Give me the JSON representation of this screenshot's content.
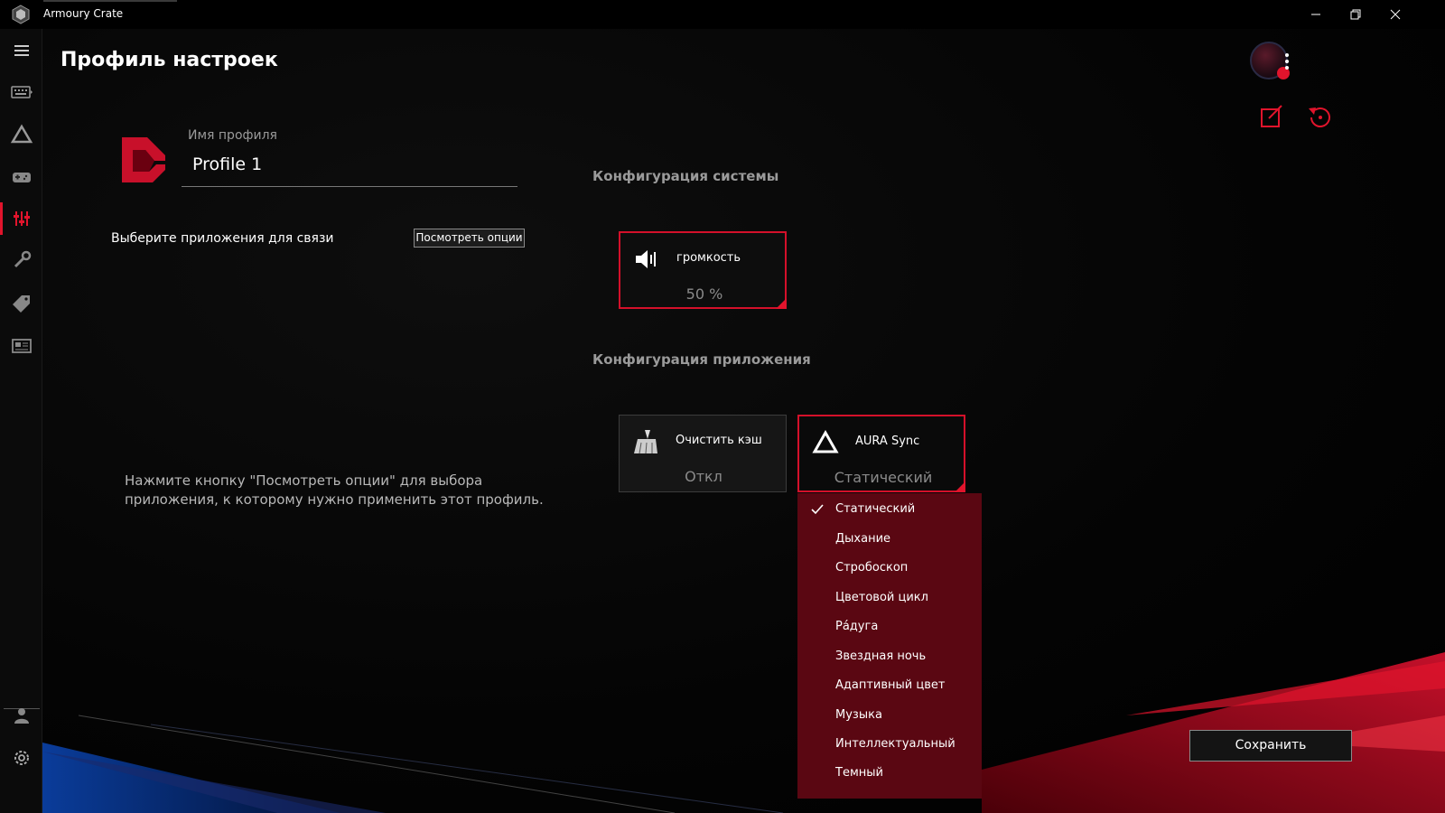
{
  "app": {
    "title": "Armoury Crate"
  },
  "window": {
    "minimize_icon": "minimize-icon",
    "restore_icon": "restore-icon",
    "close_icon": "close-icon"
  },
  "sidebar": {
    "items": [
      {
        "name": "menu",
        "icon": "hamburger-icon"
      },
      {
        "name": "devices",
        "icon": "keyboard-icon"
      },
      {
        "name": "aura",
        "icon": "aura-icon"
      },
      {
        "name": "game-library",
        "icon": "gamepad-icon"
      },
      {
        "name": "scenario-profiles",
        "icon": "sliders-icon",
        "active": true
      },
      {
        "name": "tools",
        "icon": "wrench-icon"
      },
      {
        "name": "deals",
        "icon": "tag-icon"
      },
      {
        "name": "news",
        "icon": "news-icon"
      }
    ],
    "bottom": [
      {
        "name": "user-center",
        "icon": "user-icon"
      },
      {
        "name": "settings",
        "icon": "gear-icon"
      }
    ]
  },
  "header": {
    "title": "Профиль настроек"
  },
  "profile": {
    "label": "Имя профиля",
    "name": "Profile 1"
  },
  "app_link": {
    "label": "Выберите приложения для связи",
    "button": "Посмотреть опции"
  },
  "hint": "Нажмите кнопку \"Посмотреть опции\" для выбора приложения, к которому нужно применить этот профиль.",
  "system_config": {
    "title": "Конфигурация системы",
    "volume": {
      "label": "громкость",
      "value": "50 %"
    }
  },
  "app_config": {
    "title": "Конфигурация приложения",
    "cache": {
      "label": "Очистить кэш",
      "value": "Откл"
    },
    "aura": {
      "label": "AURA Sync",
      "value": "Статический"
    }
  },
  "aura_dropdown": {
    "selected_index": 0,
    "options": [
      "Статический",
      "Дыхание",
      "Стробоскоп",
      "Цветовой цикл",
      "Рáдуга",
      "Звездная ночь",
      "Адаптивный цвет",
      "Музыка",
      "Интеллектуальный",
      "Темный"
    ]
  },
  "footer": {
    "save": "Сохранить"
  },
  "colors": {
    "accent": "#e1142c",
    "dropdown_bg": "#5a0712",
    "background": "#000000"
  }
}
